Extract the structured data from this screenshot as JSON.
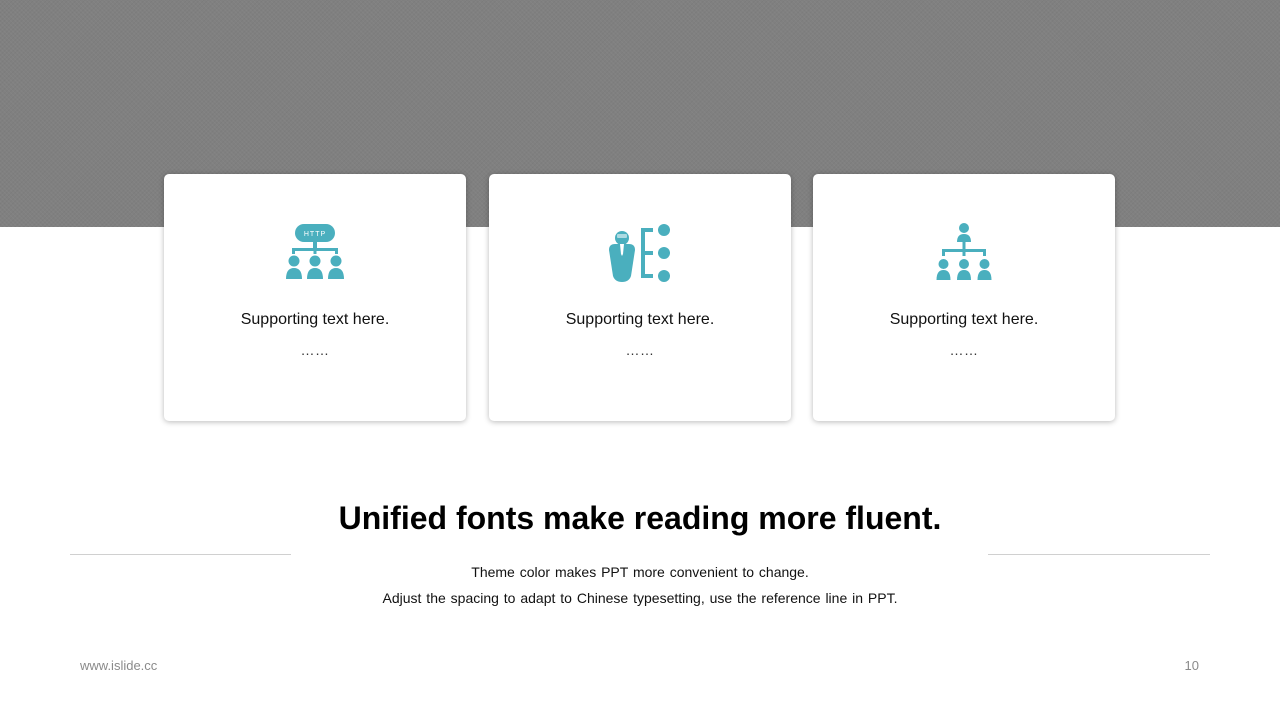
{
  "colors": {
    "accent": "#4AAFBE",
    "band": "#808080",
    "card_bg": "#FFFFFF",
    "rule": "#D0D0D0",
    "footer_text": "#8A8A8A"
  },
  "cards": [
    {
      "icon": "http-network-icon",
      "icon_text": "HTTP",
      "label": "Supporting text here.",
      "ellipsis": "……"
    },
    {
      "icon": "person-options-icon",
      "label": "Supporting text here.",
      "ellipsis": "……"
    },
    {
      "icon": "org-chart-icon",
      "label": "Supporting text here.",
      "ellipsis": "……"
    }
  ],
  "headline": "Unified fonts make reading more fluent.",
  "body": {
    "line1": "Theme color makes PPT more convenient to change.",
    "line2": "Adjust the spacing to adapt to Chinese typesetting, use the reference line in PPT."
  },
  "footer": {
    "url": "www.islide.cc",
    "page": "10"
  }
}
